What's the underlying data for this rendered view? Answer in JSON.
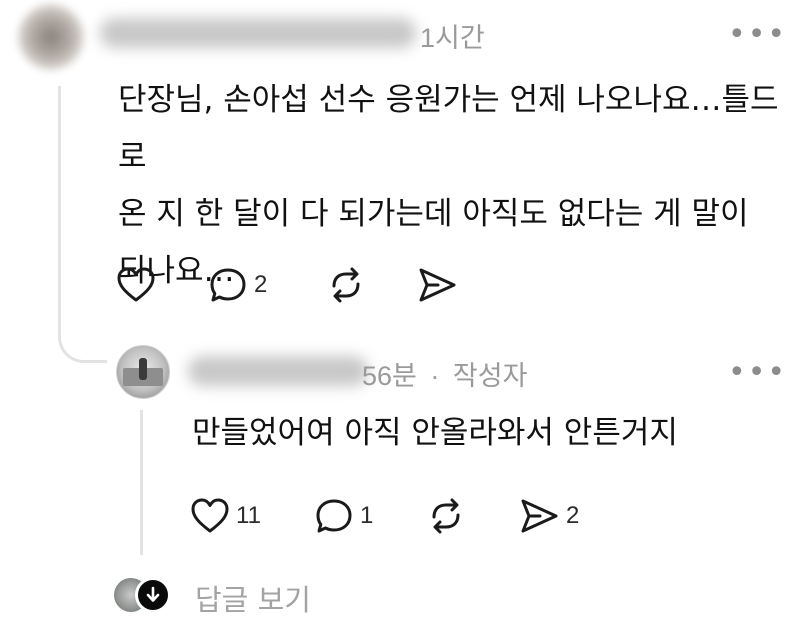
{
  "post": {
    "time": "1시간",
    "text": "단장님, 손아섭 선수 응원가는 언제 나오나요…틀드로\n온 지 한 달이 다 되가는데 아직도 없다는 게 말이\n되나요…",
    "actions": {
      "like_icon": "heart-icon",
      "reply_icon": "comment-icon",
      "reply_count": "2",
      "repost_icon": "repost-icon",
      "share_icon": "send-icon"
    }
  },
  "reply": {
    "time": "56분",
    "separator": "·",
    "author_badge": "작성자",
    "text": "만들었어여 아직 안올라와서 안튼거지",
    "actions": {
      "like_count": "11",
      "reply_count": "1",
      "share_count": "2"
    }
  },
  "footer": {
    "view_replies_label": "답글 보기"
  },
  "colors": {
    "text": "#111111",
    "muted": "#9a9a9a",
    "thread_line": "#e3e3e3"
  }
}
